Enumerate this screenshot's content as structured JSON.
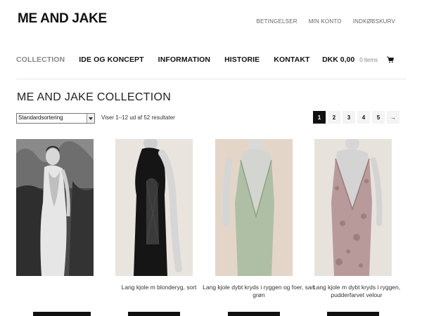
{
  "header": {
    "logo": "ME AND JAKE",
    "top_links": [
      "BETINGELSER",
      "MIN KONTO",
      "INDKØBSKURV"
    ]
  },
  "nav": {
    "items": [
      "COLLECTION",
      "IDE OG KONCEPT",
      "INFORMATION",
      "HISTORIE",
      "KONTAKT"
    ],
    "active_index": 0
  },
  "cart": {
    "total": "DKK 0,00",
    "items": "0 items",
    "icon": "cart-icon"
  },
  "page": {
    "title": "ME AND JAKE COLLECTION"
  },
  "toolbar": {
    "sort_value": "Standardsortering",
    "result_count": "Viser 1–12 ud af 52 resultater"
  },
  "pagination": {
    "pages": [
      "1",
      "2",
      "3",
      "4",
      "5"
    ],
    "current": "1",
    "next": "→"
  },
  "products": [
    {
      "name": "",
      "image": "black-and-white-photo-woman-backless-dress"
    },
    {
      "name": "Lang kjole m blonderyg, sort",
      "image": "black-dress-lace-back-mannequin"
    },
    {
      "name": "Lang kjole dybt kryds i ryggen og foer, sart grøn",
      "image": "pale-green-dress-cross-back-mannequin"
    },
    {
      "name": "Lang kjole m dybt kryds i ryggen, pudderfarvet velour",
      "image": "powder-velour-dress-cross-back-mannequin"
    }
  ],
  "colors": {
    "accent": "#111111",
    "active_nav": "#888888",
    "muted_text": "#666666"
  }
}
